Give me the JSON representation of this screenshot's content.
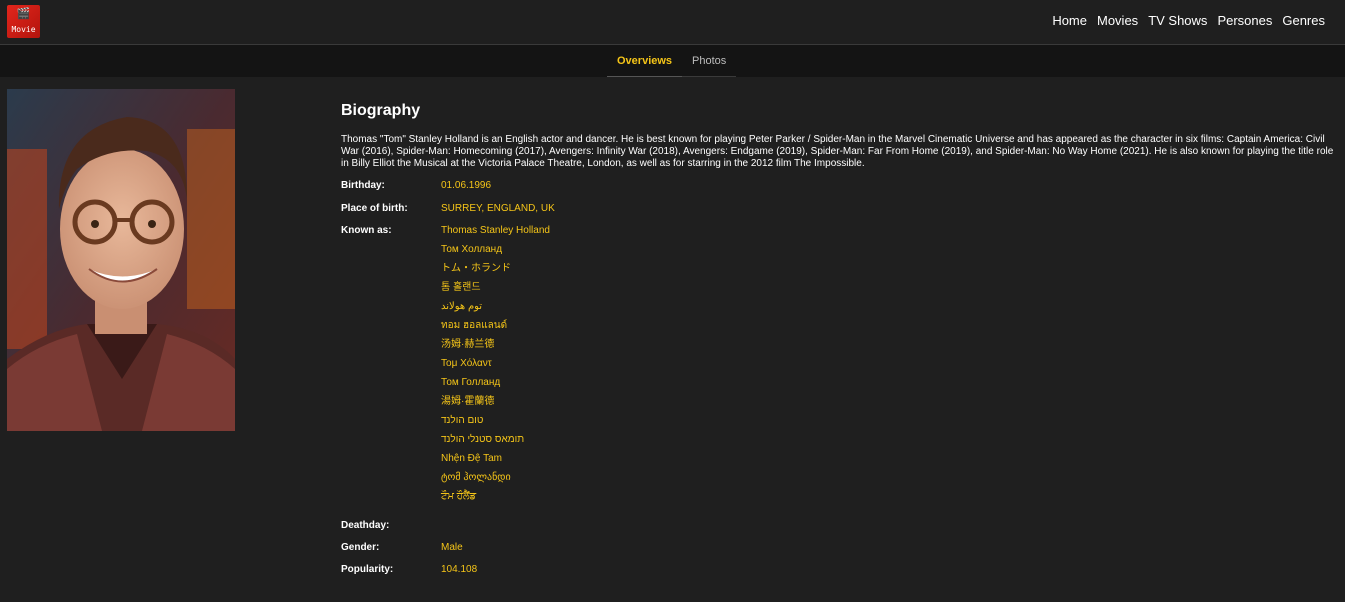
{
  "app": {
    "logo_text": "Movie",
    "logo_glyph": "🎬"
  },
  "nav": {
    "items": [
      "Home",
      "Movies",
      "TV Shows",
      "Persones",
      "Genres"
    ]
  },
  "tabs": [
    {
      "label": "Overviews",
      "active": true
    },
    {
      "label": "Photos",
      "active": false
    }
  ],
  "person": {
    "biography_title": "Biography",
    "biography": "Thomas \"Tom\" Stanley Holland is an English actor and dancer. He is best known for playing Peter Parker / Spider-Man in the Marvel Cinematic Universe and has appeared as the character in six films: Captain America: Civil War (2016), Spider-Man: Homecoming (2017), Avengers: Infinity War (2018), Avengers: Endgame (2019), Spider-Man: Far From Home (2019), and Spider-Man: No Way Home (2021). He is also known for playing the title role in Billy Elliot the Musical at the Victoria Palace Theatre, London, as well as for starring in the 2012 film The Impossible.",
    "labels": {
      "birthday": "Birthday:",
      "place_of_birth": "Place of birth:",
      "known_as": "Known as:",
      "deathday": "Deathday:",
      "gender": "Gender:",
      "popularity": "Popularity:"
    },
    "birthday": "01.06.1996",
    "place_of_birth": "SURREY, ENGLAND, UK",
    "known_as": [
      "Thomas Stanley Holland",
      "Том Холланд",
      "トム・ホランド",
      "톰 홀랜드",
      "توم هولاند",
      "ทอม ฮอลแลนด์",
      "汤姆·赫兰德",
      "Τομ Χόλαντ",
      "Том Голланд",
      "湯姆·霍蘭德",
      "טום הולנד",
      "תומאס סטנלי הולנד",
      "Nhện Đệ Tam",
      "ტომ ჰოლანდი",
      "ਟੌਮ ਹੌਲੈਂਡ"
    ],
    "deathday": "",
    "gender": "Male",
    "popularity": "104.108"
  },
  "colors": {
    "accent": "#f5c518",
    "background": "#1f1f1f",
    "subnav": "#141414"
  }
}
